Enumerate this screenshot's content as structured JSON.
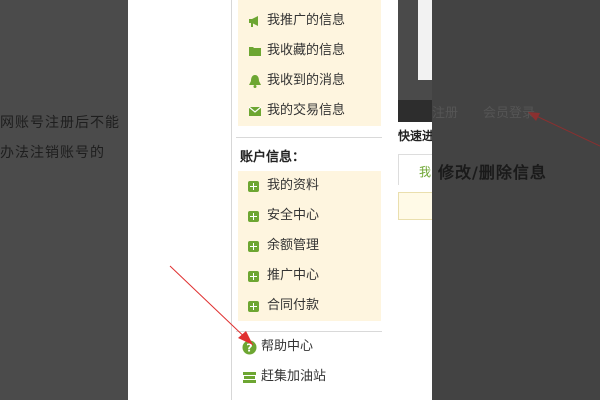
{
  "background": {
    "left_text_line1": "网账号注册后不能",
    "left_text_line2": "办法注销账号的"
  },
  "sidebar": {
    "top_items": [
      {
        "icon": "megaphone-icon",
        "label": "我推广的信息"
      },
      {
        "icon": "folder-icon",
        "label": "我收藏的信息"
      },
      {
        "icon": "bell-icon",
        "label": "我收到的消息"
      },
      {
        "icon": "envelope-icon",
        "label": "我的交易信息"
      }
    ],
    "account_title": "账户信息：",
    "account_items": [
      {
        "icon": "plus-icon",
        "label": "我的资料"
      },
      {
        "icon": "plus-icon",
        "label": "安全中心"
      },
      {
        "icon": "plus-icon",
        "label": "余额管理"
      },
      {
        "icon": "plus-icon",
        "label": "推广中心"
      },
      {
        "icon": "plus-icon",
        "label": "合同付款"
      }
    ],
    "bottom_items": [
      {
        "icon": "question-icon",
        "label": "帮助中心"
      },
      {
        "icon": "station-icon",
        "label": "赶集加油站"
      }
    ]
  },
  "right_panel": {
    "nav_register": "注册",
    "nav_member_login": "会员登录",
    "quick_label": "快速进",
    "tab_fragment": "我",
    "edit_title": "修改/删除信息"
  },
  "colors": {
    "accent_green": "#6da632",
    "sidebar_bg": "#fef5df",
    "arrow_red": "#e03030"
  }
}
